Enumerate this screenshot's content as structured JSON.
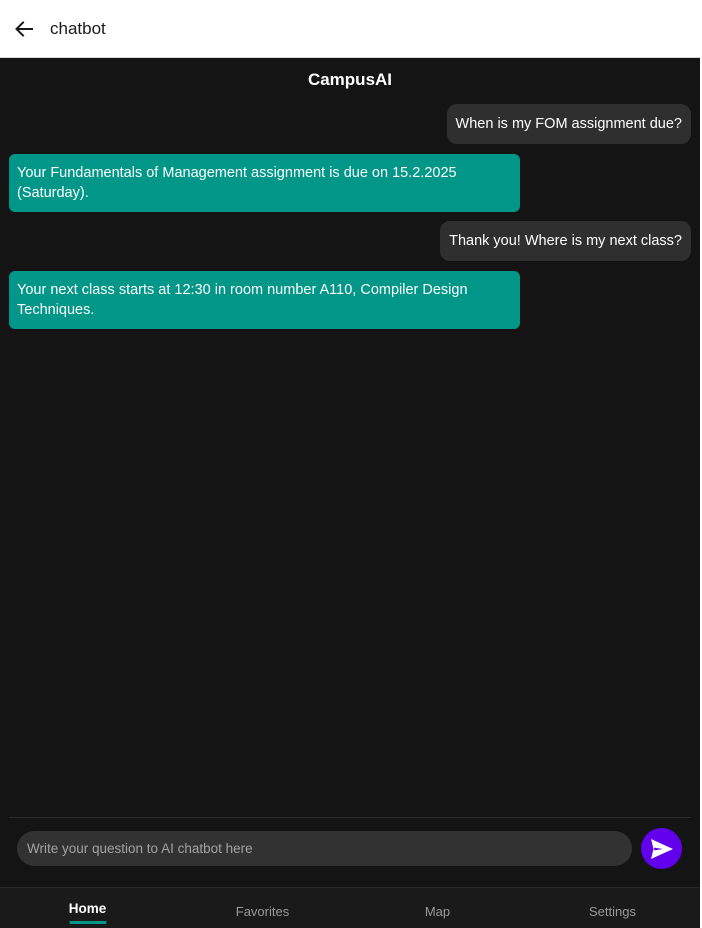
{
  "appbar": {
    "title": "chatbot",
    "back_icon": "arrow-left-icon"
  },
  "chat": {
    "header": "CampusAI",
    "messages": [
      {
        "role": "user",
        "text": "When is my FOM assignment due?"
      },
      {
        "role": "bot",
        "text": "Your Fundamentals of Management assignment is due on 15.2.2025 (Saturday)."
      },
      {
        "role": "user",
        "text": "Thank you! Where is my next class?"
      },
      {
        "role": "bot",
        "text": "Your next class starts at 12:30 in room number A110, Compiler Design Techniques."
      }
    ]
  },
  "input": {
    "placeholder": "Write your question to AI chatbot here",
    "value": "",
    "send_icon": "send-icon"
  },
  "nav": {
    "items": [
      {
        "label": "Home",
        "active": true
      },
      {
        "label": "Favorites",
        "active": false
      },
      {
        "label": "Map",
        "active": false
      },
      {
        "label": "Settings",
        "active": false
      }
    ]
  },
  "colors": {
    "bot_bubble": "#009688",
    "user_bubble": "#302f30",
    "send_button": "#6200ee",
    "background": "#151415",
    "nav_indicator": "#009688"
  }
}
